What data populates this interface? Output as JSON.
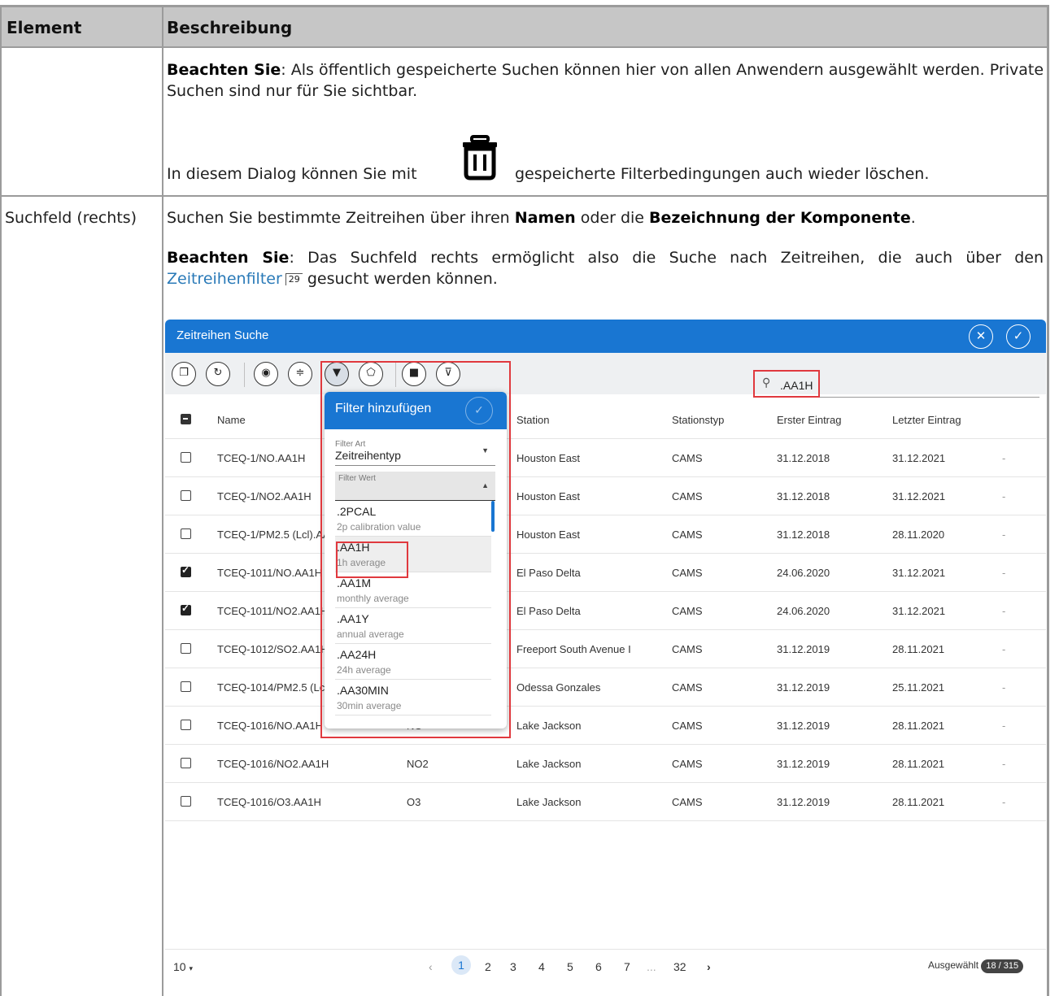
{
  "doc_table": {
    "headers": {
      "element": "Element",
      "description": "Beschreibung"
    },
    "row1": {
      "note_label": "Beachten Sie",
      "note_text": ": Als öffentlich gespeicherte Suchen können hier von allen Anwendern ausgewählt werden. Private Suchen sind nur für Sie sichtbar.",
      "delete_text_before": "In diesem Dialog können Sie mit",
      "delete_text_after": "gespeicherte Filterbedingungen auch wieder löschen."
    },
    "row2": {
      "element": "Suchfeld (rechts)",
      "intro_1": "Suchen Sie bestimmte Zeitreihen über ihren ",
      "intro_name": "Namen",
      "intro_2": " oder die ",
      "intro_component": "Bezeichnung der Komponente",
      "intro_3": ".",
      "note_label": "Beachten Sie",
      "note_text": ": Das Suchfeld rechts ermöglicht also die Suche nach Zeitreihen, die auch über den ",
      "link_text": "Zeitreihenfilter",
      "page_ref": "29",
      "note_tail": " gesucht werden können."
    }
  },
  "window": {
    "title": "Zeitreihen Suche",
    "search_value": ".AA1H",
    "columns": [
      "Name",
      "Station",
      "Stationstyp",
      "Erster Eintrag",
      "Letzter Eintrag"
    ],
    "rows": [
      {
        "name": "TCEQ-1/NO.AA1H",
        "component": "",
        "station": "Houston East",
        "type": "CAMS",
        "first": "31.12.2018",
        "last": "31.12.2021",
        "extra": "-",
        "checked": false
      },
      {
        "name": "TCEQ-1/NO2.AA1H",
        "component": "",
        "station": "Houston East",
        "type": "CAMS",
        "first": "31.12.2018",
        "last": "31.12.2021",
        "extra": "-",
        "checked": false
      },
      {
        "name": "TCEQ-1/PM2.5 (Lcl).AA1",
        "component": "",
        "station": "Houston East",
        "type": "CAMS",
        "first": "31.12.2018",
        "last": "28.11.2020",
        "extra": "-",
        "checked": false
      },
      {
        "name": "TCEQ-1011/NO.AA1H",
        "component": "",
        "station": "El Paso Delta",
        "type": "CAMS",
        "first": "24.06.2020",
        "last": "31.12.2021",
        "extra": "-",
        "checked": true
      },
      {
        "name": "TCEQ-1011/NO2.AA1H",
        "component": "",
        "station": "El Paso Delta",
        "type": "CAMS",
        "first": "24.06.2020",
        "last": "31.12.2021",
        "extra": "-",
        "checked": true
      },
      {
        "name": "TCEQ-1012/SO2.AA1H",
        "component": "",
        "station": "Freeport South Avenue I",
        "type": "CAMS",
        "first": "31.12.2019",
        "last": "28.11.2021",
        "extra": "-",
        "checked": false
      },
      {
        "name": "TCEQ-1014/PM2.5 (Lcl).",
        "component": "",
        "station": "Odessa Gonzales",
        "type": "CAMS",
        "first": "31.12.2019",
        "last": "25.11.2021",
        "extra": "-",
        "checked": false
      },
      {
        "name": "TCEQ-1016/NO.AA1H",
        "component": "NO",
        "station": "Lake Jackson",
        "type": "CAMS",
        "first": "31.12.2019",
        "last": "28.11.2021",
        "extra": "-",
        "checked": false
      },
      {
        "name": "TCEQ-1016/NO2.AA1H",
        "component": "NO2",
        "station": "Lake Jackson",
        "type": "CAMS",
        "first": "31.12.2019",
        "last": "28.11.2021",
        "extra": "-",
        "checked": false
      },
      {
        "name": "TCEQ-1016/O3.AA1H",
        "component": "O3",
        "station": "Lake Jackson",
        "type": "CAMS",
        "first": "31.12.2019",
        "last": "28.11.2021",
        "extra": "-",
        "checked": false
      }
    ],
    "footer": {
      "page_size": "10",
      "pages": [
        "1",
        "2",
        "3",
        "4",
        "5",
        "6",
        "7",
        "...",
        "32"
      ],
      "active_page": "1",
      "selected_label": "Ausgewählt",
      "selected_count": "18 / 315"
    }
  },
  "filter_popup": {
    "title": "Filter hinzufügen",
    "filter_type_label": "Filter Art",
    "filter_type_value": "Zeitreihentyp",
    "filter_value_label": "Filter Wert",
    "options": [
      {
        "code": ".2PCAL",
        "desc": "2p calibration value"
      },
      {
        "code": ".AA1H",
        "desc": "1h average",
        "selected": true
      },
      {
        "code": ".AA1M",
        "desc": "monthly average"
      },
      {
        "code": ".AA1Y",
        "desc": "annual average"
      },
      {
        "code": ".AA24H",
        "desc": "24h average"
      },
      {
        "code": ".AA30MIN",
        "desc": "30min average"
      }
    ]
  },
  "colors": {
    "accent": "#1976d2",
    "highlight": "#e0393e",
    "header_bg": "#c6c6c6"
  },
  "icons": [
    "trash-icon",
    "close-icon",
    "check-icon",
    "search-icon",
    "filter-add-icon",
    "save-icon"
  ]
}
